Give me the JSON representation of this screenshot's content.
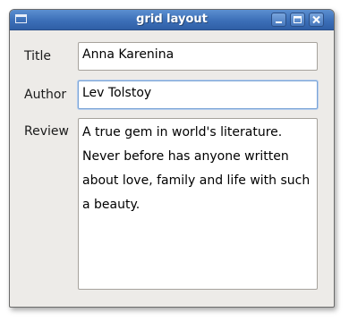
{
  "window": {
    "title": "grid layout"
  },
  "form": {
    "title_label": "Title",
    "title_value": "Anna Karenina",
    "author_label": "Author",
    "author_value": "Lev Tolstoy",
    "review_label": "Review",
    "review_value": "A true gem in world's literature. Never before has anyone written about love, family and life with such a beauty."
  },
  "colors": {
    "titlebar": "#3c6fb8",
    "window_bg": "#edebe8",
    "focus_border": "#7aa3d6"
  }
}
